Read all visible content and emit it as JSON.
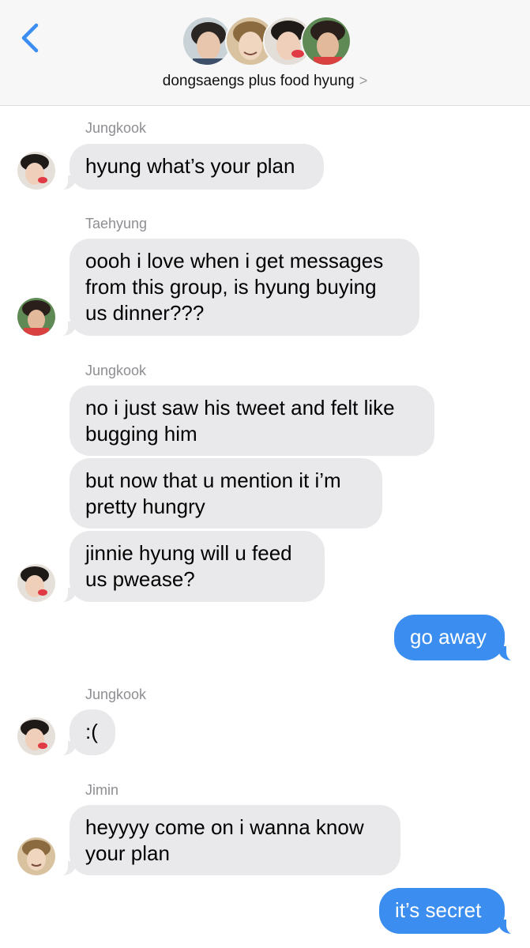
{
  "header": {
    "group_name": "dongsaengs plus food hyung",
    "chevron": ">"
  },
  "colors": {
    "accent": "#3b8ef0",
    "incoming_bubble": "#e9e9eb",
    "sender_name": "#8e8e93",
    "header_bg": "#f7f7f7"
  },
  "icons": {
    "back": "chevron-left-icon",
    "title_chevron": "chevron-right-icon"
  },
  "messages": [
    {
      "sender": "Jungkook",
      "lines": [
        "hyung what’s your plan"
      ]
    },
    {
      "sender": "Taehyung",
      "lines": [
        "oooh i love when i get messages",
        "from this group, is hyung buying",
        "us dinner???"
      ]
    },
    {
      "sender": "Jungkook",
      "lines": [
        "no i just saw his tweet and felt like",
        "bugging him"
      ]
    },
    {
      "sender": "Jungkook",
      "lines": [
        "but now that u mention it i’m",
        "pretty hungry"
      ]
    },
    {
      "sender": "Jungkook",
      "lines": [
        "jinnie hyung will u feed",
        "us pwease?"
      ]
    },
    {
      "sender": "me",
      "lines": [
        "go away"
      ]
    },
    {
      "sender": "Jungkook",
      "lines": [
        ":("
      ]
    },
    {
      "sender": "Jimin",
      "lines": [
        "heyyyy come on i wanna know",
        "your plan"
      ]
    },
    {
      "sender": "me",
      "lines": [
        "it’s secret"
      ]
    }
  ]
}
